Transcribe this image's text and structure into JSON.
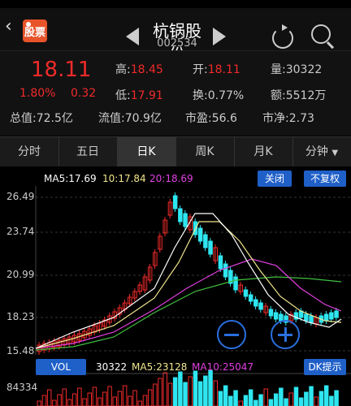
{
  "header": {
    "logo_label": "股票",
    "stock_name": "杭锅股份",
    "stock_code": "002534"
  },
  "quote": {
    "price": "18.11",
    "change_pct": "1.80%",
    "change": "0.32",
    "high_label": "高:",
    "high": "18.45",
    "low_label": "低:",
    "low": "17.91",
    "open_label": "开:",
    "open": "18.11",
    "turnover_label": "换:",
    "turnover": "0.77%",
    "volume_label": "量:",
    "volume": "30322",
    "amount_label": "额:",
    "amount": "5512万",
    "mktcap_label": "总值:",
    "mktcap": "72.5亿",
    "float_label": "流值:",
    "float": "70.9亿",
    "pe_label": "市盈:",
    "pe": "56.6",
    "pb_label": "市净:",
    "pb": "2.73"
  },
  "tabs": [
    "分时",
    "五日",
    "日K",
    "周K",
    "月K",
    "分钟"
  ],
  "active_tab": "日K",
  "chart": {
    "ma5": "MA5:17.69",
    "ma10": "10:17.84",
    "ma20": "20:18.69",
    "close_btn": "关闭",
    "adjust_btn": "不复权",
    "vol_btn": "VOL",
    "vol_value": "30322",
    "vol_ma5": "MA5:23128",
    "vol_ma10": "MA10:25047",
    "dk_btn": "DK提示",
    "y_ticks": [
      "26.49",
      "23.74",
      "20.99",
      "18.23",
      "15.48"
    ],
    "vol_tick": "84334",
    "colors": {
      "up": "#f02a2a",
      "down": "#2ee6f0",
      "ma5": "#ffffff",
      "ma10": "#f0e68c",
      "ma20": "#e040e0",
      "ma60": "#40c040"
    }
  }
}
